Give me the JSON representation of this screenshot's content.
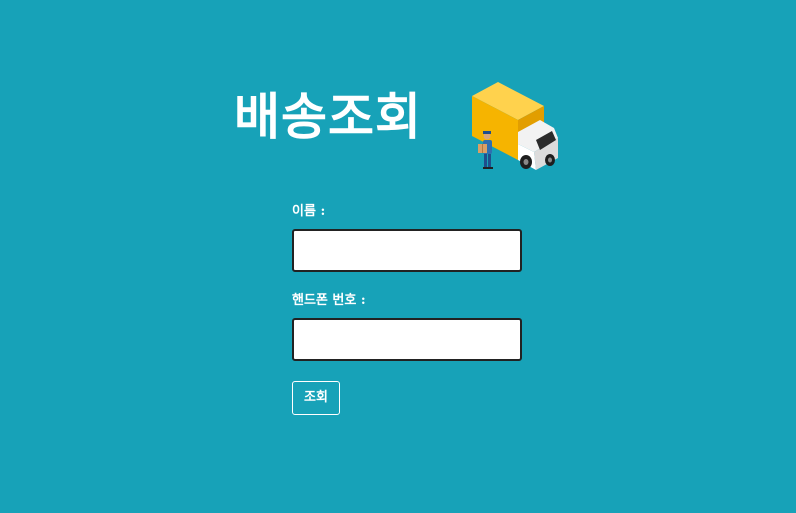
{
  "page": {
    "title": "배송조회",
    "illustration": "delivery-truck-with-courier"
  },
  "form": {
    "name_label": "이름 :",
    "name_value": "",
    "phone_label": "핸드폰 번호 :",
    "phone_value": "",
    "submit_label": "조회"
  },
  "colors": {
    "background": "#17a2b8",
    "text": "#ffffff",
    "truck_cargo": "#f6b400",
    "truck_cab": "#ffffff"
  }
}
